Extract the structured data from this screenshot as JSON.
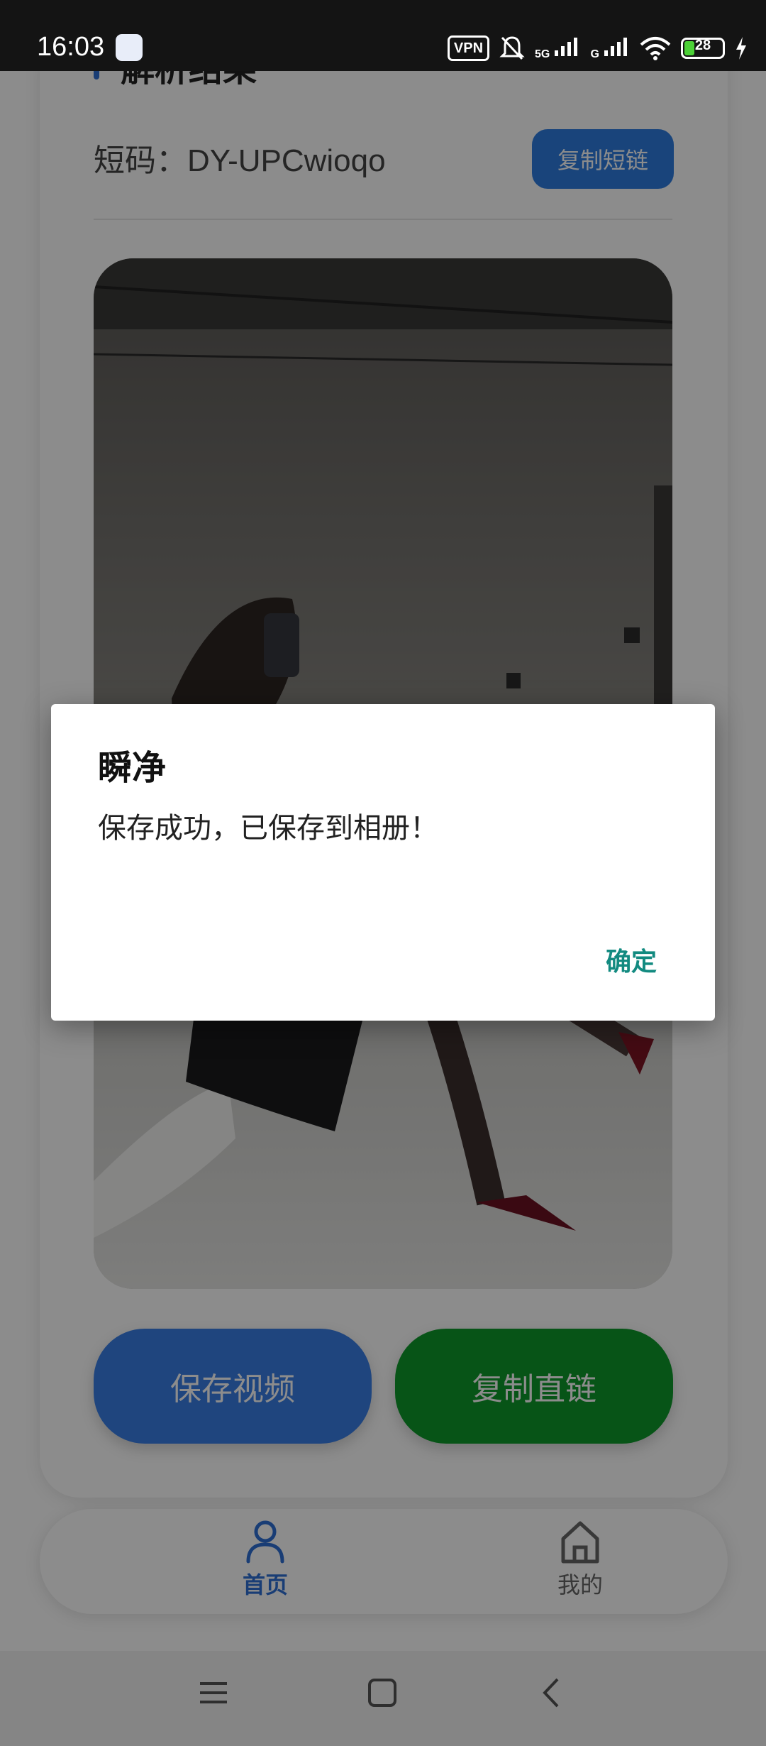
{
  "status_bar": {
    "time": "16:03",
    "vpn": "VPN",
    "network_1": "5G",
    "network_2": "G",
    "battery": "28"
  },
  "result": {
    "section_title": "解析结果",
    "short_code": "短码：DY-UPCwioqo",
    "copy_short_button": "复制短链"
  },
  "actions": {
    "save_video": "保存视频",
    "copy_direct_link": "复制直链"
  },
  "tabs": {
    "home": "首页",
    "me": "我的"
  },
  "dialog": {
    "title": "瞬净",
    "message": "保存成功，已保存到相册！",
    "ok": "确定"
  },
  "colors": {
    "accent_blue": "#2f7de1",
    "accent_green": "#0d9a2b",
    "dialog_button": "#128a80"
  }
}
